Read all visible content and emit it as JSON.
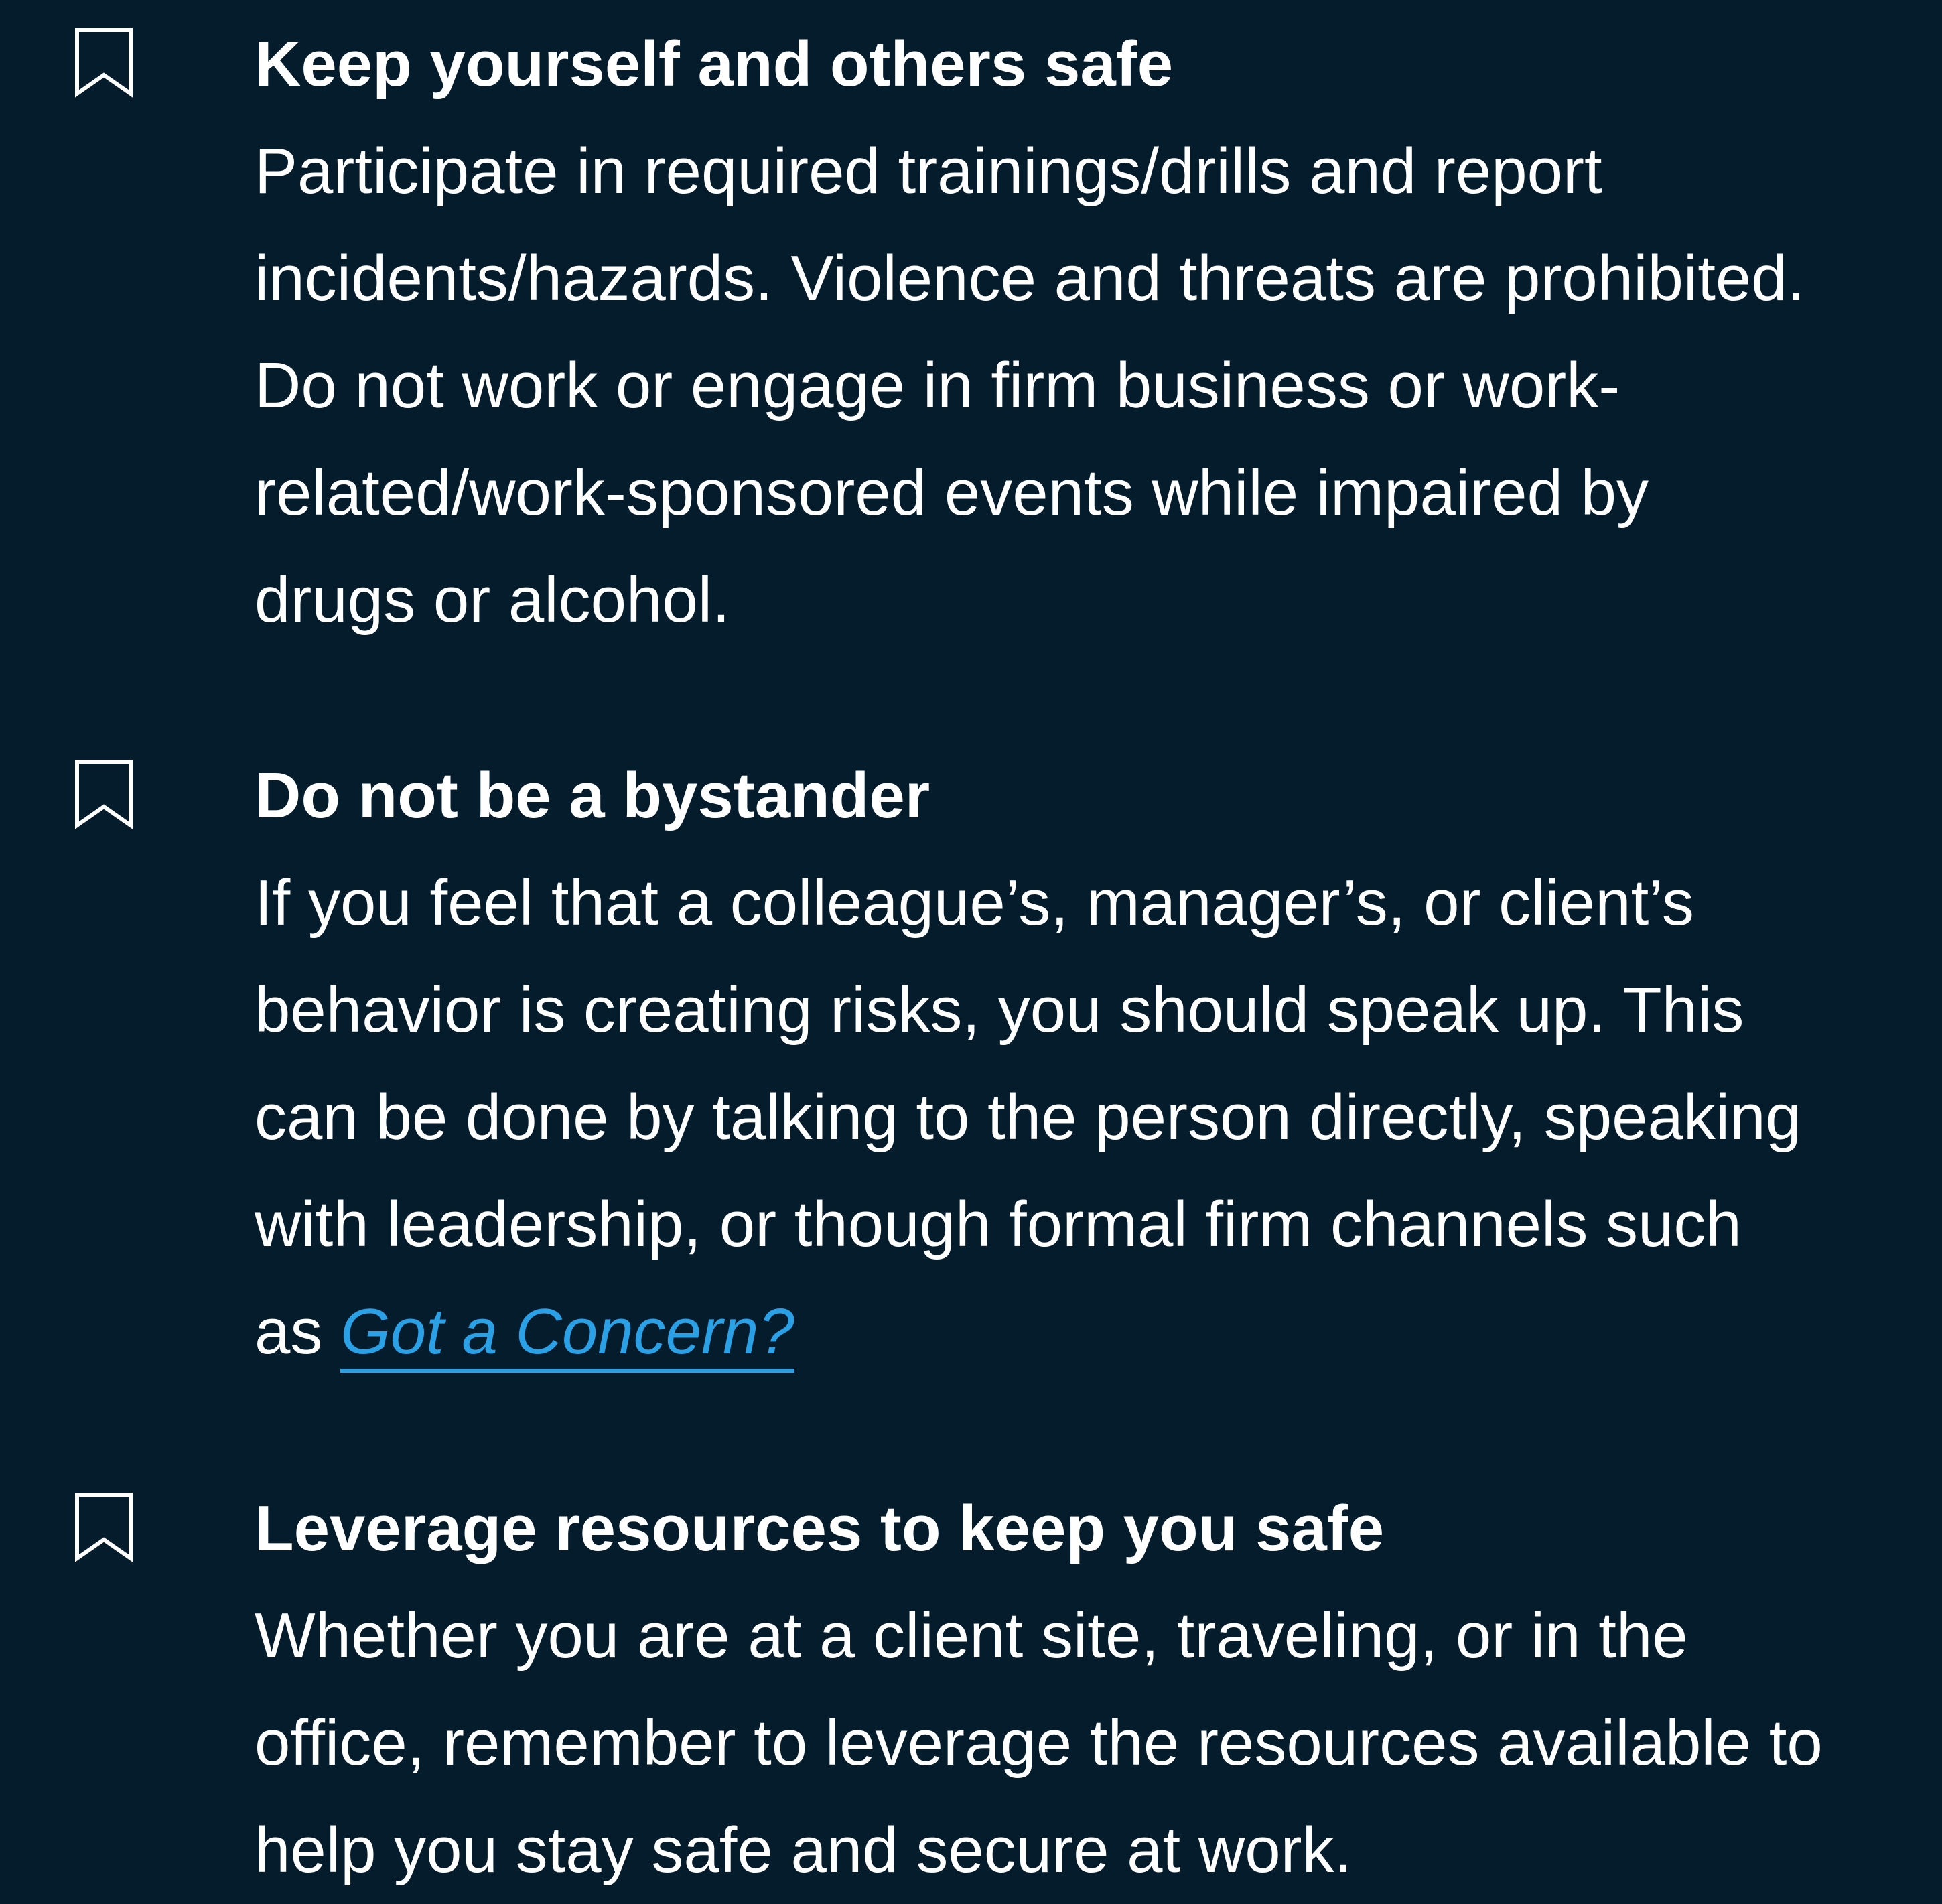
{
  "items": [
    {
      "icon": "bookmark-icon",
      "heading": "Keep yourself and others safe",
      "lines": [
        "Participate in required trainings/drills and report",
        "incidents/hazards. Violence and threats are prohibited.",
        "Do not work or engage in firm business or work-",
        "related/work-sponsored events while impaired by",
        "drugs or alcohol."
      ]
    },
    {
      "icon": "bookmark-icon",
      "heading": "Do not be a bystander",
      "lines": [
        "If you feel that a colleague’s, manager’s, or client’s",
        "behavior is creating risks, you should speak up. This",
        "can be done by talking to the person directly, speaking",
        "with leadership, or though formal firm channels such"
      ],
      "last_line_prefix": "as ",
      "link_text": "Got a Concern?"
    },
    {
      "icon": "bookmark-icon",
      "heading": "Leverage resources to keep you safe",
      "lines": [
        "Whether you are at a client site, traveling, or in the",
        "office, remember to leverage the resources available to",
        "help you stay safe and secure at work."
      ]
    }
  ],
  "colors": {
    "background": "#051c2c",
    "text": "#ffffff",
    "link": "#2aa1e6"
  }
}
